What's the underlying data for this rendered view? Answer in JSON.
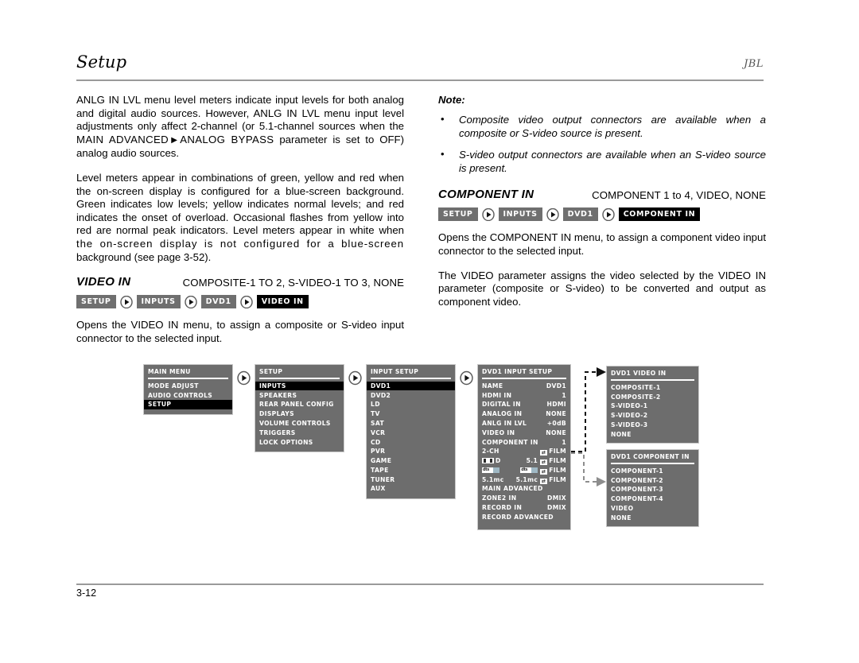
{
  "header": {
    "title": "Setup",
    "brand": "JBL"
  },
  "footer": {
    "page": "3-12"
  },
  "left_column": {
    "para1_a": "ANLG IN LVL menu level meters indicate input levels for both analog and digital audio sources. However, ANLG IN LVL menu input level adjustments only affect 2-channel (or 5.1-channel sources when the ",
    "para1_b": "MAIN ADVANCED",
    "para1_c": "ANALOG BYPASS",
    "para1_d": " parameter is set to OFF) analog audio sources.",
    "para2": "Level meters appear in combinations of green, yellow and red when the on-screen display is configured for a blue-screen background. Green indicates low levels; yellow indicates normal levels; and red indicates the onset of overload. Occasional flashes from yellow into red are normal peak indicators. Level meters appear in white when",
    "para2_tracked": "the on-screen display is not configured for a blue-screen",
    "para2_end": "background (see page 3-52).",
    "section": {
      "title": "VIDEO IN",
      "values": "COMPOSITE-1 TO 2, S-VIDEO-1 TO 3, NONE",
      "crumbs": [
        "SETUP",
        "INPUTS",
        "DVD1",
        "VIDEO IN"
      ],
      "description": "Opens the VIDEO IN menu, to assign a composite or S-video input connector to the selected input."
    }
  },
  "right_column": {
    "note_heading": "Note:",
    "notes": [
      "Composite video output connectors are available when a composite or S-video source is present.",
      "S-video output connectors are available when an S-video source is present."
    ],
    "bullet_glyph": "•",
    "section": {
      "title": "COMPONENT IN",
      "values": "COMPONENT 1 to 4, VIDEO, NONE",
      "crumbs": [
        "SETUP",
        "INPUTS",
        "DVD1",
        "COMPONENT IN"
      ],
      "para1": "Opens the COMPONENT IN menu, to assign a component video input connector to the selected input.",
      "para2": "The VIDEO parameter assigns the video selected by the VIDEO IN parameter (composite or S-video) to be converted and output as component video."
    }
  },
  "diagram": {
    "panels": {
      "main_menu": {
        "title": "MAIN MENU",
        "items": [
          "MODE ADJUST",
          "AUDIO CONTROLS",
          "SETUP"
        ],
        "selected": "SETUP"
      },
      "setup": {
        "title": "SETUP",
        "items": [
          "INPUTS",
          "SPEAKERS",
          "REAR PANEL CONFIG",
          "DISPLAYS",
          "VOLUME CONTROLS",
          "TRIGGERS",
          "LOCK OPTIONS"
        ],
        "selected": "INPUTS"
      },
      "input_setup": {
        "title": "INPUT SETUP",
        "items": [
          "DVD1",
          "DVD2",
          "LD",
          "TV",
          "SAT",
          "VCR",
          "CD",
          "PVR",
          "GAME",
          "TAPE",
          "TUNER",
          "AUX"
        ],
        "selected": "DVD1"
      },
      "dvd1_input_setup": {
        "title": "DVD1 INPUT SETUP",
        "rows": [
          {
            "label": "NAME",
            "value": "DVD1"
          },
          {
            "label": "HDMI IN",
            "value": "1"
          },
          {
            "label": "DIGITAL IN",
            "value": "HDMI"
          },
          {
            "label": "ANALOG IN",
            "value": "NONE"
          },
          {
            "label": "ANLG IN LVL",
            "value": "+0dB"
          },
          {
            "label": "VIDEO IN",
            "value": "NONE"
          },
          {
            "label": "COMPONENT IN",
            "value": "1"
          },
          {
            "label": "2-CH",
            "value": "FILM"
          },
          {
            "label": "D",
            "mid": "5.1",
            "value": "FILM",
            "icon": "dolby-digital-logo"
          },
          {
            "label": "",
            "mid": "",
            "value": "FILM",
            "icon": "dts-logo",
            "mid_icon": "dts-logo"
          },
          {
            "label": "5.1mc",
            "mid": "5.1mc",
            "value": "FILM"
          },
          {
            "label": "MAIN ADVANCED",
            "value": ""
          },
          {
            "label": "ZONE2 IN",
            "value": "DMIX"
          },
          {
            "label": "RECORD IN",
            "value": "DMIX"
          },
          {
            "label": "RECORD ADVANCED",
            "value": ""
          }
        ]
      },
      "dvd1_video_in": {
        "title": "DVD1 VIDEO IN",
        "items": [
          "COMPOSITE-1",
          "COMPOSITE-2",
          "S-VIDEO-1",
          "S-VIDEO-2",
          "S-VIDEO-3",
          "NONE"
        ]
      },
      "dvd1_component_in": {
        "title": "DVD1 COMPONENT IN",
        "items": [
          "COMPONENT-1",
          "COMPONENT-2",
          "COMPONENT-3",
          "COMPONENT-4",
          "VIDEO",
          "NONE"
        ]
      }
    }
  },
  "colors": {
    "panel_bg": "#6d6d6d",
    "panel_border": "#c9c9c9",
    "selected_bg": "#000000",
    "chip_bg": "#6f6f6f",
    "chip_active_bg": "#000000",
    "rule": "#9a9a9a"
  }
}
